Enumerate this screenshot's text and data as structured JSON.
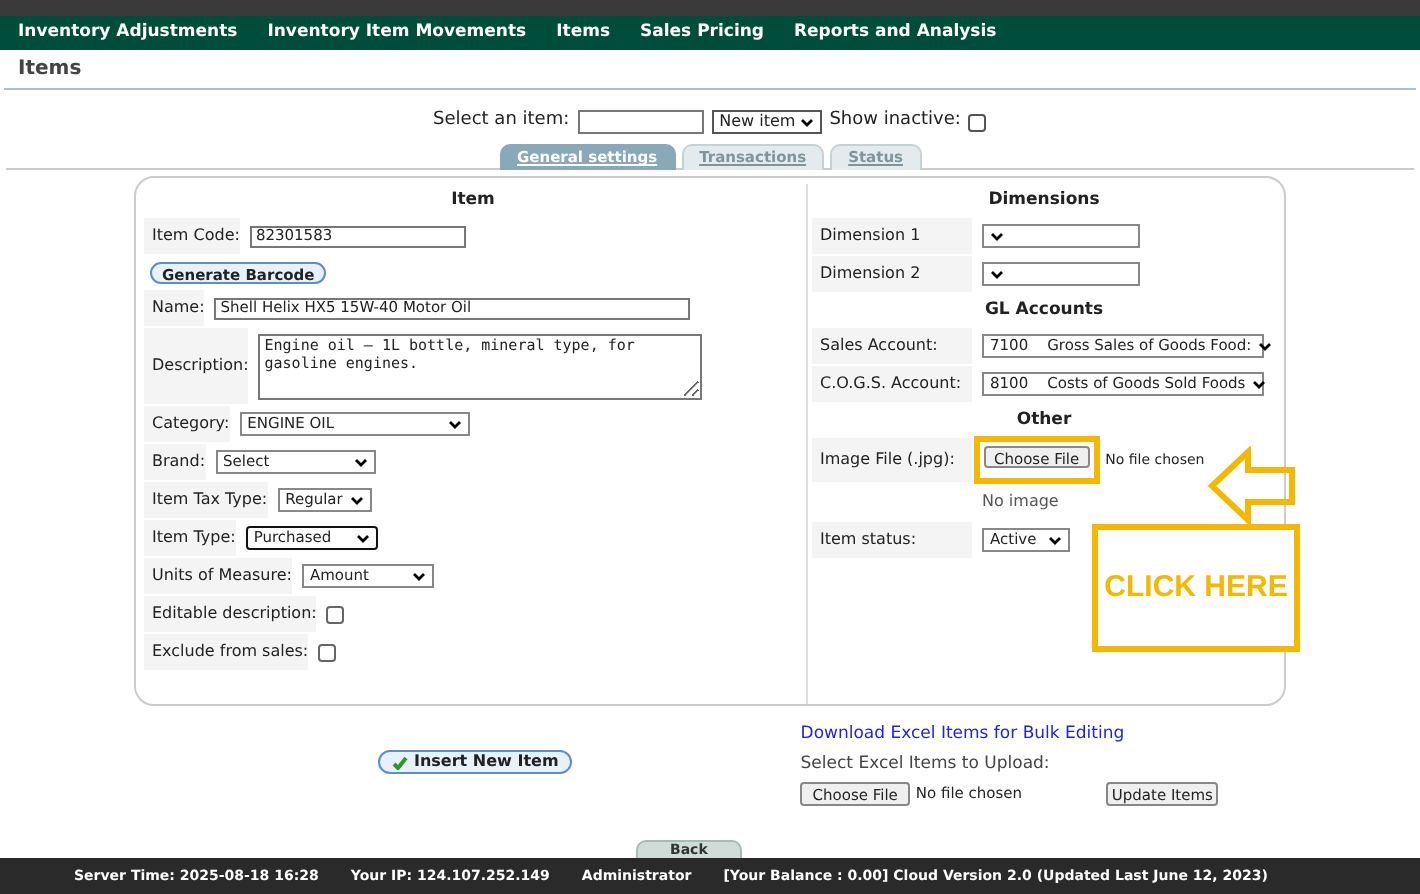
{
  "nav": [
    "Inventory Adjustments",
    "Inventory Item Movements",
    "Items",
    "Sales Pricing",
    "Reports and Analysis"
  ],
  "page_title": "Items",
  "selector": {
    "label": "Select an item:",
    "dropdown": "New item",
    "show_inactive": "Show inactive:",
    "checked": false
  },
  "tabs": [
    {
      "label": "General settings",
      "selected": true
    },
    {
      "label": "Transactions",
      "selected": false
    },
    {
      "label": "Status",
      "selected": false
    }
  ],
  "item_section": {
    "title": "Item",
    "fields": [
      {
        "kind": "text",
        "label": "Item Code:",
        "value": "82301583"
      },
      {
        "kind": "button",
        "value": "Generate Barcode"
      },
      {
        "kind": "wide",
        "label": "Name:",
        "value": "Shell Helix HX5 15W-40 Motor Oil"
      },
      {
        "kind": "textarea",
        "label": "Description:",
        "value": "Engine oil – 1L bottle, mineral type, for gasoline engines."
      },
      {
        "kind": "select",
        "label": "Category:",
        "value": "ENGINE OIL",
        "focused": false
      },
      {
        "kind": "select",
        "label": "Brand:",
        "value": "Select",
        "focused": false
      },
      {
        "kind": "select",
        "label": "Item Tax Type:",
        "value": "Regular",
        "focused": false
      },
      {
        "kind": "select",
        "label": "Item Type:",
        "value": "Purchased",
        "focused": true
      },
      {
        "kind": "select",
        "label": "Units of Measure:",
        "value": "Amount",
        "focused": false
      },
      {
        "kind": "checkbox",
        "label": "Editable description:",
        "checked": false
      },
      {
        "kind": "checkbox",
        "label": "Exclude from sales:",
        "checked": false
      }
    ]
  },
  "right_sections": [
    {
      "title": "Dimensions",
      "fields": [
        {
          "kind": "select",
          "label": "Dimension 1",
          "focused": false
        },
        {
          "kind": "select",
          "label": "Dimension 2",
          "focused": false
        }
      ]
    },
    {
      "title": "GL Accounts",
      "fields": [
        {
          "kind": "select",
          "label": "Sales Account:",
          "value": "7100    Gross Sales of Goods Food:",
          "focused": false
        },
        {
          "kind": "select",
          "label": "C.O.G.S. Account:",
          "value": "8100    Costs of Goods Sold Foods",
          "focused": false
        }
      ]
    },
    {
      "title": "Other",
      "fields": [
        {
          "kind": "file",
          "label": "Image File (.jpg):",
          "value": "Choose File",
          "status": "No file chosen"
        },
        {
          "kind": "note",
          "value": "No image"
        },
        {
          "kind": "select",
          "label": "Item status:",
          "value": "Active",
          "focused": false
        }
      ]
    }
  ],
  "annotation": "CLICK HERE",
  "insert_button": "Insert New Item",
  "upload": {
    "link": "Download Excel Items for Bulk Editing",
    "label": "Select Excel Items to Upload:",
    "choose": "Choose File",
    "status": "No file chosen",
    "button": "Update Items"
  },
  "back_button": "Back",
  "footer": [
    "Server Time: 2025-08-18 16:28",
    "Your IP: 124.107.252.149",
    "Administrator",
    "[Your Balance : 0.00] Cloud Version 2.0 (Updated Last June 12, 2023)"
  ]
}
